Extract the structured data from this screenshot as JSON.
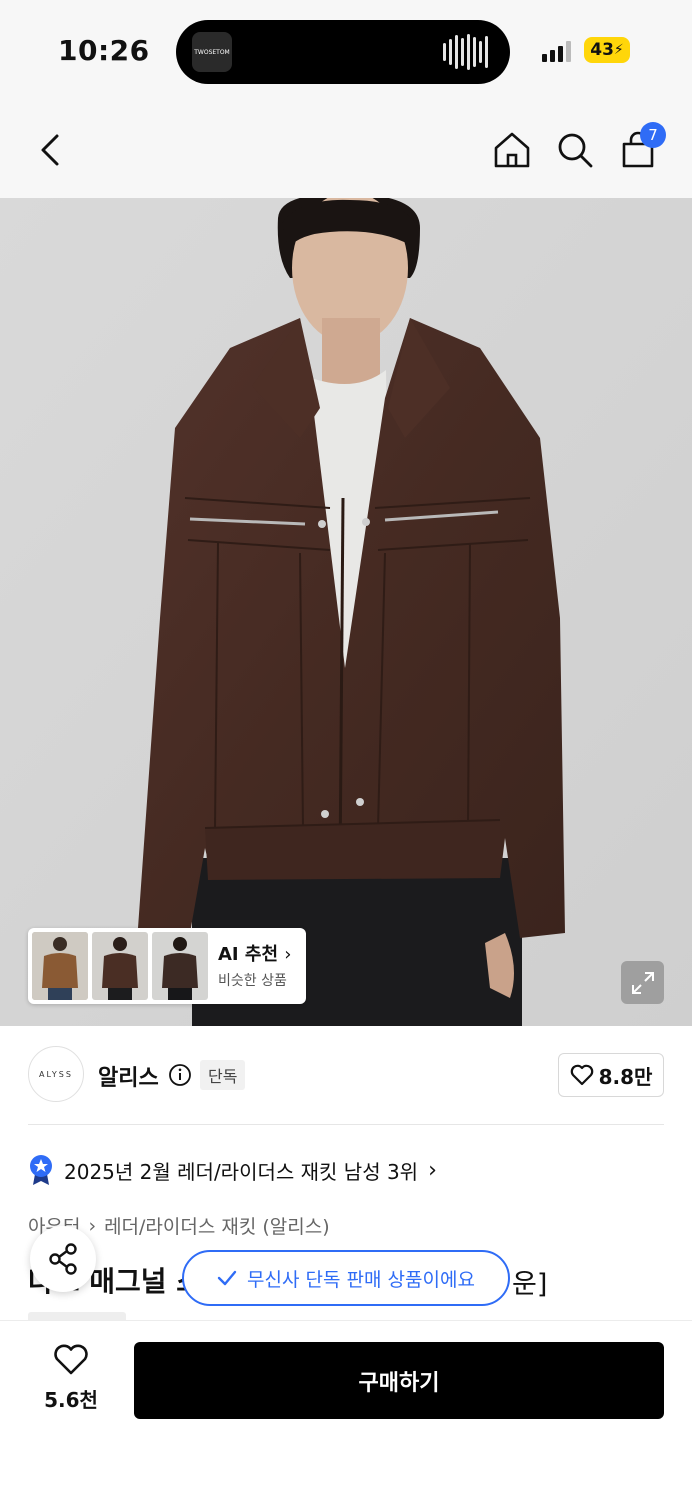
{
  "status": {
    "time": "10:26",
    "battery": "43",
    "island_app": "TWOSETOM"
  },
  "nav": {
    "cart_count": "7"
  },
  "ai_recommend": {
    "title": "AI 추천",
    "subtitle": "비슷한 상품"
  },
  "brand": {
    "logo_text": "ALYSS",
    "name": "알리스",
    "exclusive": "단독",
    "likes": "8.8만"
  },
  "ranking": {
    "text": "2025년 2월 레더/라이더스 재킷 남성 3위"
  },
  "breadcrumb": {
    "category": "아우터",
    "subcategory": "레더/라이더스 재킷 (알리스)"
  },
  "product": {
    "title_start": "다크 매그널 스",
    "title_end": "운]"
  },
  "toast": {
    "text": "무신사 단독 판매 상품이에요"
  },
  "bottom": {
    "wish_count": "5.6천",
    "buy_label": "구매하기"
  },
  "colors": {
    "accent": "#2f6cf6",
    "battery": "#ffd60a",
    "jacket": "#4a2c22"
  }
}
